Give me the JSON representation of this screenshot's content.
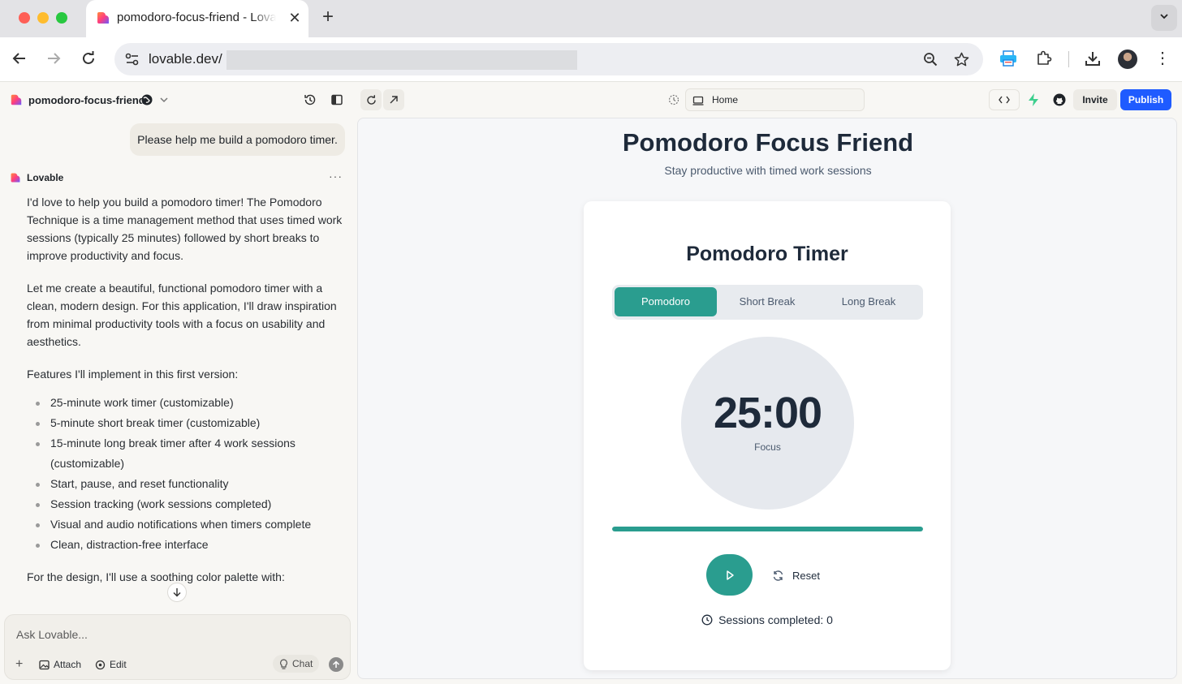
{
  "browser": {
    "tab_title": "pomodoro-focus-friend - Lovable",
    "url": "lovable.dev/"
  },
  "project": {
    "name": "pomodoro-focus-friend"
  },
  "chat": {
    "user_message": "Please help me build a pomodoro timer.",
    "assistant_name": "Lovable",
    "paragraphs": [
      "I'd love to help you build a pomodoro timer! The Pomodoro Technique is a time management method that uses timed work sessions (typically 25 minutes) followed by short breaks to improve productivity and focus.",
      "Let me create a beautiful, functional pomodoro timer with a clean, modern design. For this application, I'll draw inspiration from minimal productivity tools with a focus on usability and aesthetics.",
      "Features I'll implement in this first version:"
    ],
    "features": [
      "25-minute work timer (customizable)",
      "5-minute short break timer (customizable)",
      "15-minute long break timer after 4 work sessions (customizable)",
      "Start, pause, and reset functionality",
      "Session tracking (work sessions completed)",
      "Visual and audio notifications when timers complete",
      "Clean, distraction-free interface"
    ],
    "design_intro": "For the design, I'll use a soothing color palette with:",
    "composer_placeholder": "Ask Lovable...",
    "attach_label": "Attach",
    "edit_label": "Edit",
    "chat_label": "Chat"
  },
  "preview_header": {
    "route": "Home",
    "invite_label": "Invite",
    "publish_label": "Publish"
  },
  "app_preview": {
    "title": "Pomodoro Focus Friend",
    "subtitle": "Stay productive with timed work sessions",
    "card_title": "Pomodoro Timer",
    "tabs": [
      "Pomodoro",
      "Short Break",
      "Long Break"
    ],
    "active_tab": 0,
    "time": "25:00",
    "mode": "Focus",
    "progress_percent": 100,
    "reset_label": "Reset",
    "sessions_text": "Sessions completed: 0"
  },
  "colors": {
    "accent": "#2a9d8f",
    "publish": "#1f5bff"
  }
}
